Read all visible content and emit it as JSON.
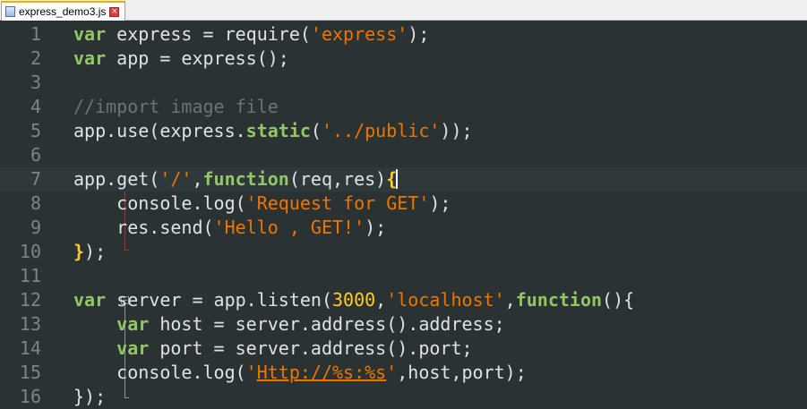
{
  "tab": {
    "filename": "express_demo3.js",
    "close_glyph": "×",
    "file_icon": "js-file-icon",
    "close_icon": "close-tab-icon"
  },
  "colors": {
    "background": "#2b3234",
    "keyword": "#93c763",
    "string": "#ec7600",
    "number": "#ffcd22",
    "comment": "#66747b",
    "text": "#e0e2e4",
    "line_number": "#7b8587",
    "fold_active": "#c42626"
  },
  "editor": {
    "current_line": 7,
    "lines": [
      {
        "n": "1",
        "tokens": [
          {
            "t": "kw",
            "v": "var"
          },
          {
            "t": "p",
            "v": " express = require("
          },
          {
            "t": "str",
            "v": "'express'"
          },
          {
            "t": "p",
            "v": ");"
          }
        ]
      },
      {
        "n": "2",
        "tokens": [
          {
            "t": "kw",
            "v": "var"
          },
          {
            "t": "p",
            "v": " app = express();"
          }
        ]
      },
      {
        "n": "3",
        "tokens": []
      },
      {
        "n": "4",
        "tokens": [
          {
            "t": "cmt",
            "v": "//import image file"
          }
        ]
      },
      {
        "n": "5",
        "tokens": [
          {
            "t": "p",
            "v": "app.use(express."
          },
          {
            "t": "kw",
            "v": "static"
          },
          {
            "t": "p",
            "v": "("
          },
          {
            "t": "str",
            "v": "'../public'"
          },
          {
            "t": "p",
            "v": "));"
          }
        ]
      },
      {
        "n": "6",
        "tokens": []
      },
      {
        "n": "7",
        "tokens": [
          {
            "t": "p",
            "v": "app.get("
          },
          {
            "t": "str",
            "v": "'/'"
          },
          {
            "t": "p",
            "v": ","
          },
          {
            "t": "kw",
            "v": "function"
          },
          {
            "t": "p",
            "v": "(req,res)"
          },
          {
            "t": "brace",
            "v": "{"
          },
          {
            "t": "caret",
            "v": ""
          }
        ]
      },
      {
        "n": "8",
        "tokens": [
          {
            "t": "p",
            "v": "    console.log("
          },
          {
            "t": "str",
            "v": "'Request for GET'"
          },
          {
            "t": "p",
            "v": ");"
          }
        ]
      },
      {
        "n": "9",
        "tokens": [
          {
            "t": "p",
            "v": "    res.send("
          },
          {
            "t": "str",
            "v": "'Hello , GET!'"
          },
          {
            "t": "p",
            "v": ");"
          }
        ]
      },
      {
        "n": "10",
        "tokens": [
          {
            "t": "brace",
            "v": "}"
          },
          {
            "t": "p",
            "v": ");"
          }
        ]
      },
      {
        "n": "11",
        "tokens": []
      },
      {
        "n": "12",
        "tokens": [
          {
            "t": "kw",
            "v": "var"
          },
          {
            "t": "p",
            "v": " server = app.listen("
          },
          {
            "t": "num",
            "v": "3000"
          },
          {
            "t": "p",
            "v": ","
          },
          {
            "t": "str",
            "v": "'localhost'"
          },
          {
            "t": "p",
            "v": ","
          },
          {
            "t": "kw",
            "v": "function"
          },
          {
            "t": "p",
            "v": "(){"
          }
        ]
      },
      {
        "n": "13",
        "tokens": [
          {
            "t": "p",
            "v": "    "
          },
          {
            "t": "kw",
            "v": "var"
          },
          {
            "t": "p",
            "v": " host = server.address().address;"
          }
        ]
      },
      {
        "n": "14",
        "tokens": [
          {
            "t": "p",
            "v": "    "
          },
          {
            "t": "kw",
            "v": "var"
          },
          {
            "t": "p",
            "v": " port = server.address().port;"
          }
        ]
      },
      {
        "n": "15",
        "tokens": [
          {
            "t": "p",
            "v": "    console.log("
          },
          {
            "t": "str",
            "v": "'"
          },
          {
            "t": "strlink",
            "v": "Http://%s:%s"
          },
          {
            "t": "str",
            "v": "'"
          },
          {
            "t": "p",
            "v": ",host,port);"
          }
        ]
      },
      {
        "n": "16",
        "tokens": [
          {
            "t": "p",
            "v": "});"
          }
        ]
      }
    ]
  }
}
